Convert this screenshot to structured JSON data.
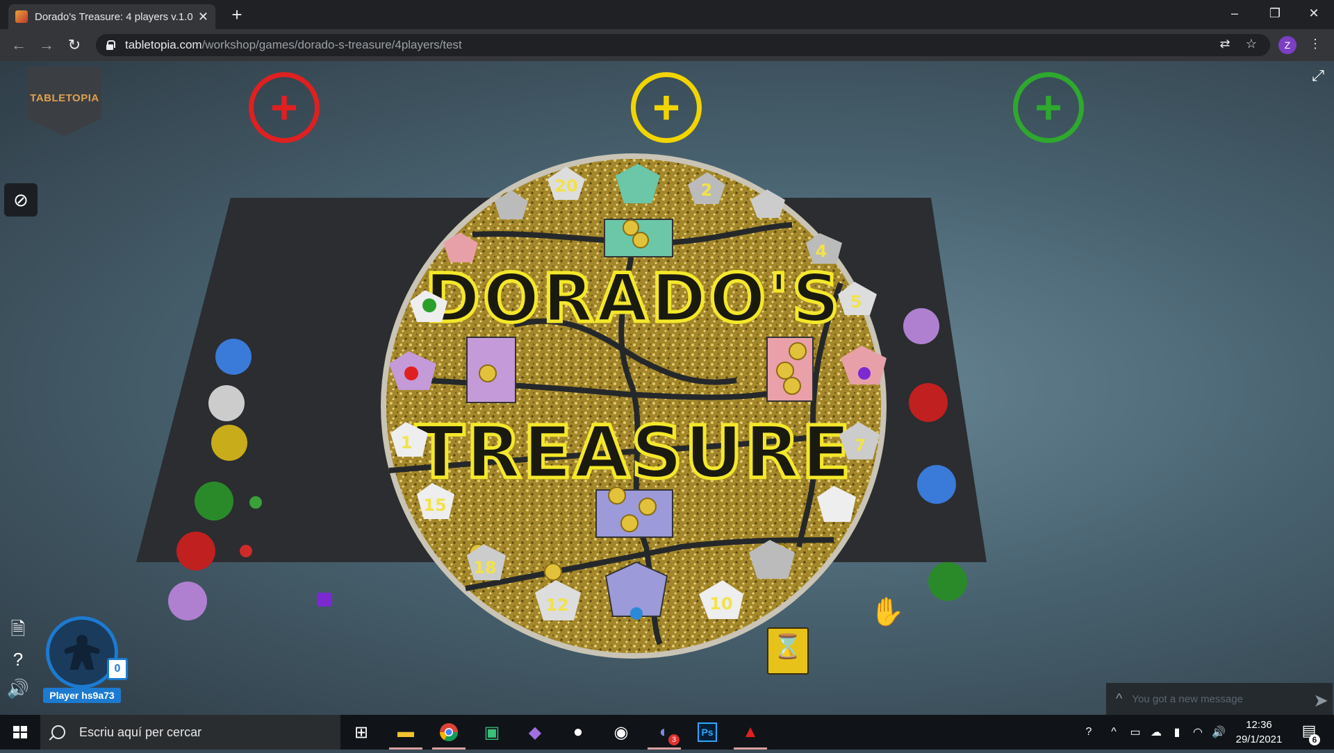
{
  "browser": {
    "tab_title": "Dorado's Treasure: 4 players v.1.0",
    "tab_close": "✕",
    "new_tab": "+",
    "url_domain": "tabletopia.com",
    "url_path": "/workshop/games/dorado-s-treasure/4players/test",
    "profile_initial": "Z",
    "window_controls": [
      "–",
      "❐",
      "✕"
    ]
  },
  "game": {
    "logo_text": "TABLETOPIA",
    "add_player_colors": [
      "#e02020",
      "#f2d500",
      "#2ea82e"
    ],
    "add_symbol": "+",
    "board_title_1": "DORADO'S",
    "board_title_2": "TREASURE",
    "board_numbers": [
      "20",
      "2",
      "4",
      "5",
      "7",
      "10",
      "12",
      "1",
      "15",
      "18"
    ],
    "player_name": "Player hs9a73",
    "player_count": "0",
    "chat_placeholder": "You got a new message",
    "accent_color": "#1d7ad0"
  },
  "taskbar": {
    "search_placeholder": "Escriu aquí per cercar",
    "time": "12:36",
    "date": "29/1/2021",
    "notification_count": "6",
    "discord_badge": "3"
  }
}
